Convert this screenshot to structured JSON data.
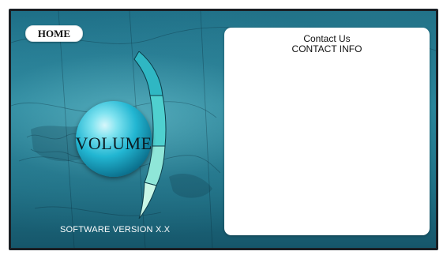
{
  "header": {
    "home_label": "HOME"
  },
  "volume": {
    "label": "VOLUME",
    "segments": 4
  },
  "footer": {
    "version_text": "SOFTWARE VERSION X.X"
  },
  "contact_panel": {
    "title": "Contact Us",
    "subtitle": "CONTACT INFO"
  },
  "colors": {
    "frame": "#1a1f24",
    "screen_teal": "#2a8aa0",
    "knob_blue": "#22b6d2",
    "segment_mint": "#bff5e6",
    "panel_bg": "#ffffff"
  },
  "icons": {
    "volume_knob": "volume-knob-icon"
  }
}
